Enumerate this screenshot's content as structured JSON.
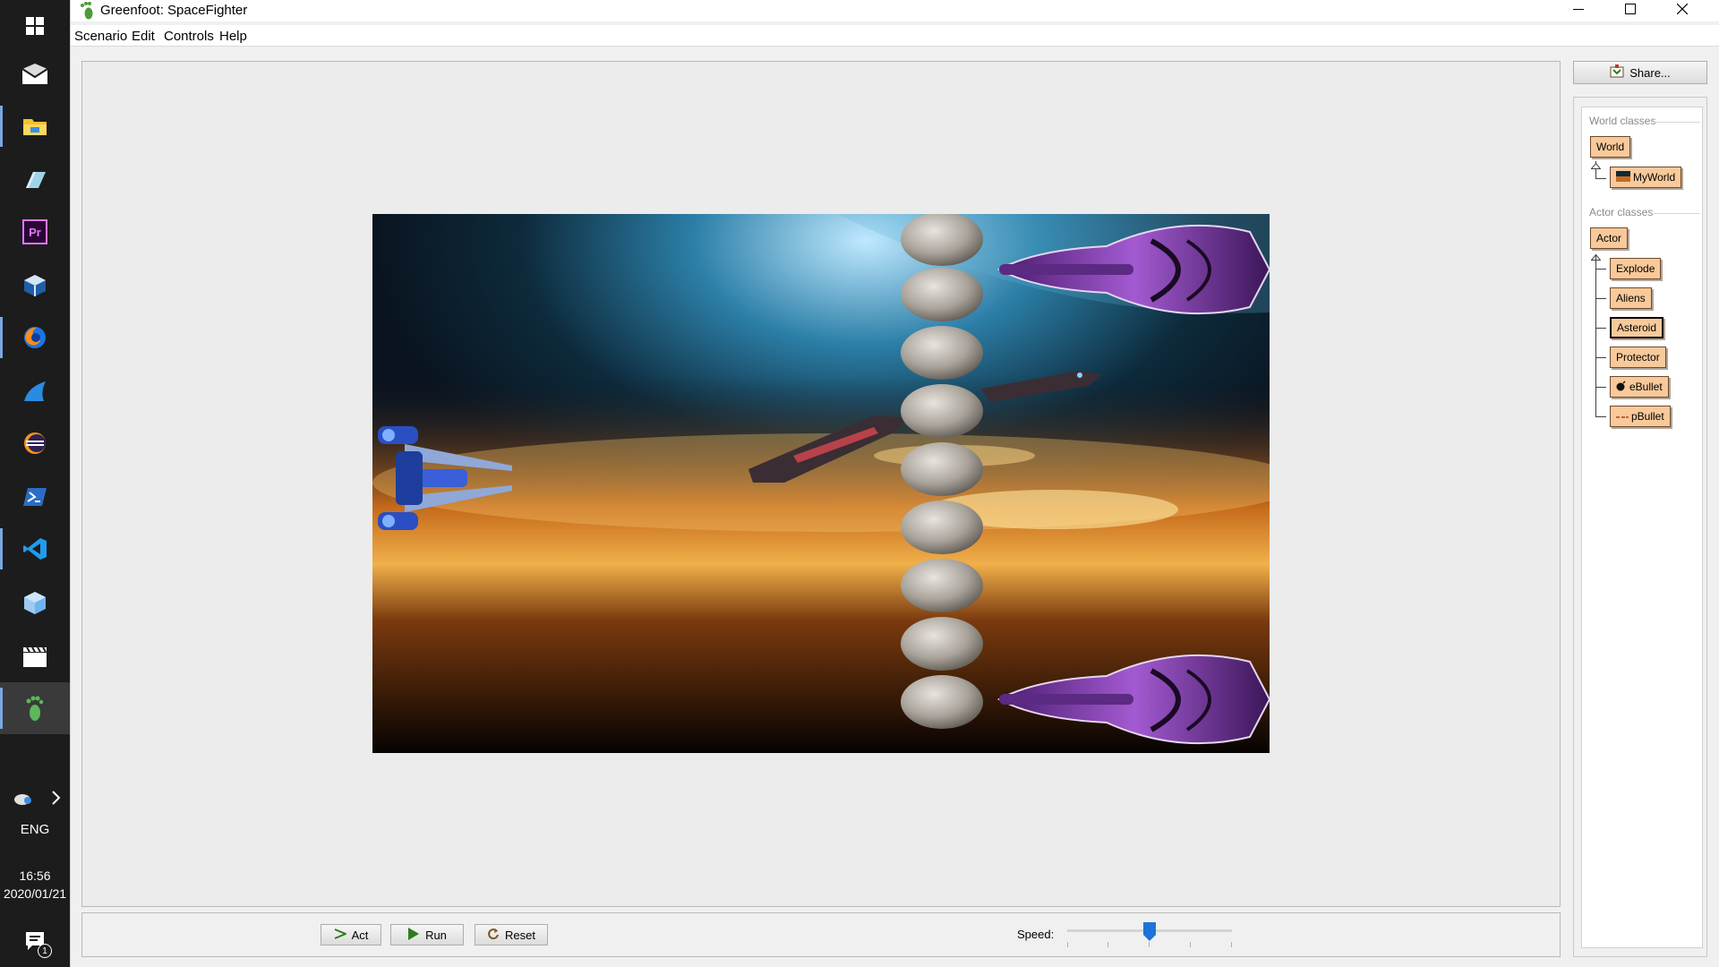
{
  "window": {
    "title": "Greenfoot: SpaceFighter",
    "menu": [
      "Scenario",
      "Edit",
      "Controls",
      "Help"
    ],
    "icons": [
      "app-footprint-icon",
      "minimize-icon",
      "maximize-icon",
      "close-icon"
    ]
  },
  "taskbar": {
    "apps": [
      "windows-start-icon",
      "mail-icon",
      "file-explorer-icon",
      "eraser-app-icon",
      "premiere-pro-icon",
      "virtualbox-icon",
      "firefox-icon",
      "sql-developer-icon",
      "eclipse-icon",
      "powershell-icon",
      "vscode-icon",
      "3d-box-icon",
      "clapperboard-icon",
      "greenfoot-icon"
    ],
    "premiere_label": "Pr",
    "language": "ENG",
    "time": "16:56",
    "date": "2020/01/21",
    "notification_count": "1"
  },
  "controls": {
    "act_label": "Act",
    "run_label": "Run",
    "reset_label": "Reset",
    "speed_label": "Speed:",
    "speed_value": 0.5
  },
  "share": {
    "label": "Share..."
  },
  "classes": {
    "world_section": "World classes",
    "world_root": "World",
    "world_subclasses": [
      "MyWorld"
    ],
    "actor_section": "Actor classes",
    "actor_root": "Actor",
    "actor_subclasses": [
      "Explode",
      "Aliens",
      "Asteroid",
      "Protector",
      "eBullet",
      "pBullet"
    ],
    "selected": "Asteroid"
  },
  "world": {
    "scene_objects": [
      "planet-background",
      "protector-ship",
      "asteroid-column",
      "alien-mothership-top",
      "alien-mothership-bottom",
      "alien-fighters"
    ]
  }
}
